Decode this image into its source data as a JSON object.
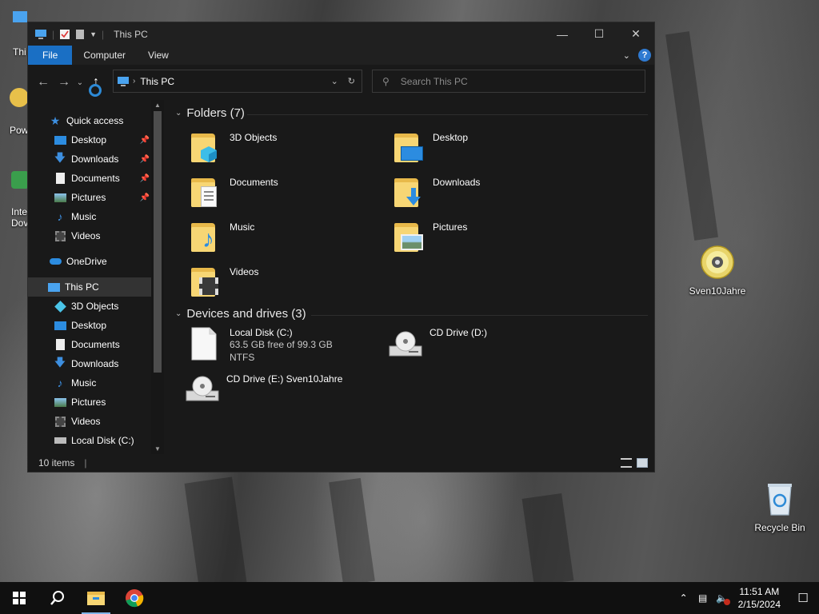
{
  "desktop": {
    "icons": [
      {
        "label": "Sven10Jahre"
      },
      {
        "label": "Recycle Bin"
      }
    ],
    "partial_labels": [
      "Thi",
      "Pow",
      "Inte",
      "Dov"
    ]
  },
  "window": {
    "title": "This PC",
    "ribbon_tabs": [
      "File",
      "Computer",
      "View"
    ],
    "help_label": "?",
    "address": "This PC",
    "search_placeholder": "Search This PC",
    "nav": {
      "quick_access": "Quick access",
      "quick_items": [
        "Desktop",
        "Downloads",
        "Documents",
        "Pictures",
        "Music",
        "Videos"
      ],
      "onedrive": "OneDrive",
      "this_pc": "This PC",
      "pc_items": [
        "3D Objects",
        "Desktop",
        "Documents",
        "Downloads",
        "Music",
        "Pictures",
        "Videos",
        "Local Disk (C:)"
      ]
    },
    "folders_header": "Folders (7)",
    "folders": [
      "3D Objects",
      "Desktop",
      "Documents",
      "Downloads",
      "Music",
      "Pictures",
      "Videos"
    ],
    "drives_header": "Devices and drives (3)",
    "drives": {
      "c_name": "Local Disk (C:)",
      "c_free": "63.5 GB free of 99.3 GB",
      "c_fs": "NTFS",
      "d_name": "CD Drive (D:)",
      "e_name": "CD Drive (E:) Sven10Jahre"
    },
    "status": "10 items"
  },
  "taskbar": {
    "time": "11:51 AM",
    "date": "2/15/2024"
  },
  "colors": {
    "accent": "#1a6fc4",
    "folder": "#f7d674"
  }
}
